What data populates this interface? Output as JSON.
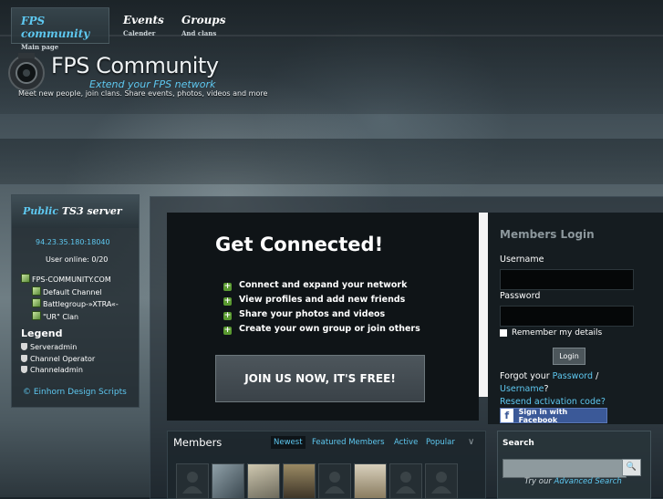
{
  "header": {
    "title": "FPS Community",
    "tagline": "Extend your FPS network",
    "subline": "Meet new people, join clans. Share events, photos, videos and more"
  },
  "nav": {
    "items": [
      {
        "label": "FPS community",
        "sub": "Main page"
      },
      {
        "label": "Events",
        "sub": "Calender"
      },
      {
        "label": "Groups",
        "sub": "And clans"
      }
    ]
  },
  "sidebar": {
    "title_prefix": "Public",
    "title_suffix": "TS3 server",
    "ip": "94.23.35.180:18040",
    "online": "User online: 0/20",
    "tree": [
      "FPS-COMMUNITY.COM",
      "Default Channel",
      "Battlegroup-»XTRA«-",
      "\"UR\" Clan"
    ],
    "legend_title": "Legend",
    "legend": [
      "Serveradmin",
      "Channel Operator",
      "Channeladmin"
    ],
    "copyright": "© Einhorn Design Scripts"
  },
  "hero": {
    "headline": "Get Connected!",
    "features": [
      "Connect and expand your network",
      "View profiles and add new friends",
      "Share your photos and videos",
      "Create your own group or join others"
    ],
    "cta": "JOIN US NOW, IT'S FREE!"
  },
  "login": {
    "title": "Members Login",
    "username_label": "Username",
    "password_label": "Password",
    "remember": "Remember my details",
    "button": "Login",
    "forgot_prefix": "Forgot your",
    "forgot_password": "Password",
    "forgot_sep": "/",
    "forgot_username": "Username",
    "forgot_q": "?",
    "resend": "Resend activation code?",
    "facebook": "Sign in with Facebook"
  },
  "members": {
    "title": "Members",
    "tabs": [
      "Newest",
      "Featured Members",
      "Active",
      "Popular"
    ],
    "avatar_count": 8
  },
  "search": {
    "title": "Search",
    "try_prefix": "Try our",
    "advanced": "Advanced Search"
  },
  "colors": {
    "accent": "#5ec8f0",
    "facebook": "#3b5998",
    "feature_icon": "#5a9a30"
  }
}
